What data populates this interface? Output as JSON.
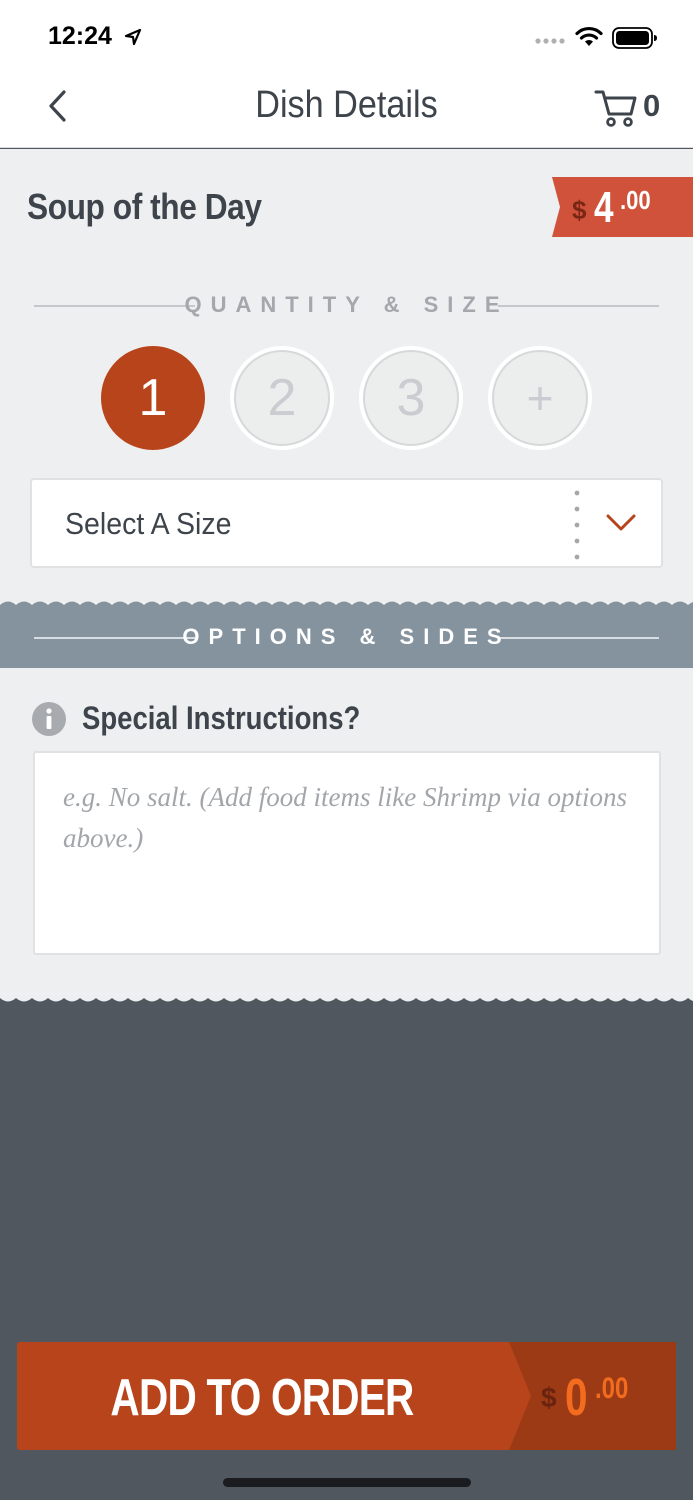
{
  "status_bar": {
    "time": "12:24"
  },
  "nav": {
    "title": "Dish Details",
    "cart_count": "0"
  },
  "dish": {
    "name": "Soup of the Day",
    "price": {
      "currency": "$",
      "whole": "4",
      "cents": ".00"
    }
  },
  "quantity_section": {
    "title": "QUANTITY & SIZE",
    "options": [
      "1",
      "2",
      "3",
      "+"
    ],
    "selected": "1"
  },
  "size_select": {
    "label": "Select A Size"
  },
  "options_section": {
    "title": "OPTIONS & SIDES"
  },
  "instructions": {
    "label": "Special Instructions?",
    "placeholder": "e.g. No salt. (Add food items like Shrimp via options above.)",
    "value": ""
  },
  "footer": {
    "add_label": "ADD TO ORDER",
    "total": {
      "currency": "$",
      "whole": "0",
      "cents": ".00"
    }
  },
  "colors": {
    "accent": "#b8441c",
    "price_tag": "#d0523a",
    "options_band": "#85939e",
    "dark_bg": "#50575f",
    "text": "#3e444b"
  }
}
